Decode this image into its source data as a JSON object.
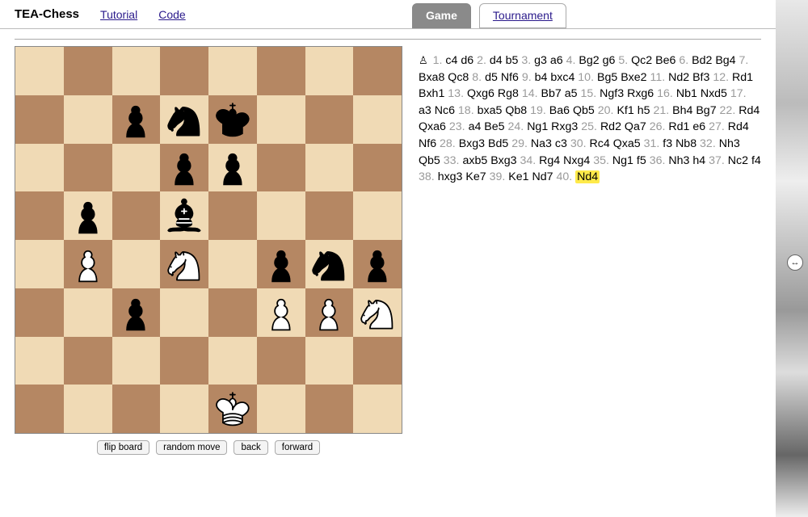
{
  "app": {
    "brand": "TEA-Chess"
  },
  "nav": {
    "tutorial": "Tutorial",
    "code": "Code"
  },
  "tabs": {
    "game": "Game",
    "tournament": "Tournament",
    "active": "game"
  },
  "controls": {
    "flip": "flip board",
    "random": "random move",
    "back": "back",
    "forward": "forward"
  },
  "board": {
    "light": "#f0dab5",
    "dark": "#b58763",
    "position": [
      [
        "",
        "",
        "",
        "",
        "",
        "",
        "",
        ""
      ],
      [
        "",
        "",
        "bP",
        "bN",
        "bK",
        "",
        "",
        ""
      ],
      [
        "",
        "",
        "",
        "bP",
        "bP",
        "",
        "",
        ""
      ],
      [
        "",
        "bP",
        "",
        "bB",
        "",
        "",
        "",
        ""
      ],
      [
        "",
        "wP",
        "",
        "wN",
        "",
        "bP",
        "bN",
        "bP"
      ],
      [
        "",
        "",
        "bP",
        "",
        "",
        "wP",
        "wP",
        "wN"
      ],
      [
        "",
        "",
        "",
        "",
        "",
        "",
        "",
        ""
      ],
      [
        "",
        "",
        "",
        "",
        "wK",
        "",
        "",
        ""
      ]
    ]
  },
  "pgn": {
    "turn_icon": "♙",
    "moves": [
      {
        "n": 1,
        "w": "c4",
        "b": "d6"
      },
      {
        "n": 2,
        "w": "d4",
        "b": "b5"
      },
      {
        "n": 3,
        "w": "g3",
        "b": "a6"
      },
      {
        "n": 4,
        "w": "Bg2",
        "b": "g6"
      },
      {
        "n": 5,
        "w": "Qc2",
        "b": "Be6"
      },
      {
        "n": 6,
        "w": "Bd2",
        "b": "Bg4"
      },
      {
        "n": 7,
        "w": "Bxa8",
        "b": "Qc8"
      },
      {
        "n": 8,
        "w": "d5",
        "b": "Nf6"
      },
      {
        "n": 9,
        "w": "b4",
        "b": "bxc4"
      },
      {
        "n": 10,
        "w": "Bg5",
        "b": "Bxe2"
      },
      {
        "n": 11,
        "w": "Nd2",
        "b": "Bf3"
      },
      {
        "n": 12,
        "w": "Rd1",
        "b": "Bxh1"
      },
      {
        "n": 13,
        "w": "Qxg6",
        "b": "Rg8"
      },
      {
        "n": 14,
        "w": "Bb7",
        "b": "a5"
      },
      {
        "n": 15,
        "w": "Ngf3",
        "b": "Rxg6"
      },
      {
        "n": 16,
        "w": "Nb1",
        "b": "Nxd5"
      },
      {
        "n": 17,
        "w": "a3",
        "b": "Nc6"
      },
      {
        "n": 18,
        "w": "bxa5",
        "b": "Qb8"
      },
      {
        "n": 19,
        "w": "Ba6",
        "b": "Qb5"
      },
      {
        "n": 20,
        "w": "Kf1",
        "b": "h5"
      },
      {
        "n": 21,
        "w": "Bh4",
        "b": "Bg7"
      },
      {
        "n": 22,
        "w": "Rd4",
        "b": "Qxa6"
      },
      {
        "n": 23,
        "w": "a4",
        "b": "Be5"
      },
      {
        "n": 24,
        "w": "Ng1",
        "b": "Rxg3"
      },
      {
        "n": 25,
        "w": "Rd2",
        "b": "Qa7"
      },
      {
        "n": 26,
        "w": "Rd1",
        "b": "e6"
      },
      {
        "n": 27,
        "w": "Rd4",
        "b": "Nf6"
      },
      {
        "n": 28,
        "w": "Bxg3",
        "b": "Bd5"
      },
      {
        "n": 29,
        "w": "Na3",
        "b": "c3"
      },
      {
        "n": 30,
        "w": "Rc4",
        "b": "Qxa5"
      },
      {
        "n": 31,
        "w": "f3",
        "b": "Nb8"
      },
      {
        "n": 32,
        "w": "Nh3",
        "b": "Qb5"
      },
      {
        "n": 33,
        "w": "axb5",
        "b": "Bxg3"
      },
      {
        "n": 34,
        "w": "Rg4",
        "b": "Nxg4"
      },
      {
        "n": 35,
        "w": "Ng1",
        "b": "f5"
      },
      {
        "n": 36,
        "w": "Nh3",
        "b": "h4"
      },
      {
        "n": 37,
        "w": "Nc2",
        "b": "f4"
      },
      {
        "n": 38,
        "w": "hxg3",
        "b": "Ke7"
      },
      {
        "n": 39,
        "w": "Ke1",
        "b": "Nd7"
      },
      {
        "n": 40,
        "w": "Nd4",
        "b": null
      }
    ],
    "current": {
      "n": 40,
      "side": "w"
    }
  }
}
